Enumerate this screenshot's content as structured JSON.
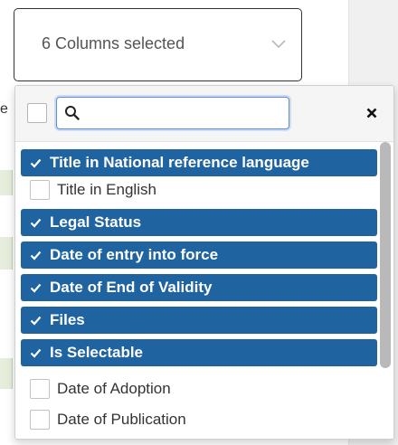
{
  "select": {
    "label": "6 Columns selected"
  },
  "background": {
    "partial_letter": "e"
  },
  "dropdown": {
    "search": {
      "value": "",
      "placeholder": ""
    },
    "options": [
      {
        "label": "Title in National reference language",
        "selected": true
      },
      {
        "label": "Title in English",
        "selected": false
      },
      {
        "label": "Legal Status",
        "selected": true
      },
      {
        "label": "Date of entry into force",
        "selected": true
      },
      {
        "label": "Date of End of Validity",
        "selected": true
      },
      {
        "label": "Files",
        "selected": true
      },
      {
        "label": "Is Selectable",
        "selected": true
      },
      {
        "label": "Date of Adoption",
        "selected": false
      },
      {
        "label": "Date of Publication",
        "selected": false
      }
    ]
  },
  "icons": {
    "chevron": "chevron-down-icon",
    "search": "search-icon",
    "close": "close-icon",
    "check": "checkmark-icon"
  },
  "colors": {
    "selected_bg": "#1f63a0",
    "selected_text": "#ffffff",
    "search_focus": "#5b8fd6",
    "panel_bg": "#f0f0f0",
    "chip_bg": "#e6eddc"
  }
}
